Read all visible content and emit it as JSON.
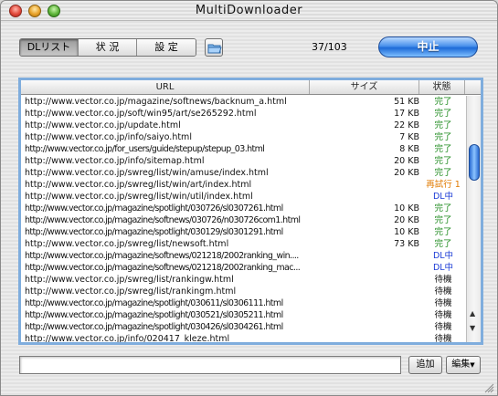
{
  "window": {
    "title": "MultiDownloader"
  },
  "toolbar": {
    "tabs": [
      "DLリスト",
      "状 況",
      "設 定"
    ],
    "counter": "37/103",
    "stop_label": "中止"
  },
  "list": {
    "headers": {
      "url": "URL",
      "size": "サイズ",
      "state": "状態"
    },
    "rows": [
      {
        "url": "http://www.vector.co.jp/magazine/softnews/backnum_a.html",
        "size": "51 KB",
        "state": "完了",
        "kind": "done",
        "compact": false
      },
      {
        "url": "http://www.vector.co.jp/soft/win95/art/se265292.html",
        "size": "17 KB",
        "state": "完了",
        "kind": "done",
        "compact": false
      },
      {
        "url": "http://www.vector.co.jp/update.html",
        "size": "22 KB",
        "state": "完了",
        "kind": "done",
        "compact": false
      },
      {
        "url": "http://www.vector.co.jp/info/saiyo.html",
        "size": "7 KB",
        "state": "完了",
        "kind": "done",
        "compact": false
      },
      {
        "url": "http://www.vector.co.jp/for_users/guide/stepup/stepup_03.html",
        "size": "8 KB",
        "state": "完了",
        "kind": "done",
        "compact": true
      },
      {
        "url": "http://www.vector.co.jp/info/sitemap.html",
        "size": "20 KB",
        "state": "完了",
        "kind": "done",
        "compact": false
      },
      {
        "url": "http://www.vector.co.jp/swreg/list/win/amuse/index.html",
        "size": "20 KB",
        "state": "完了",
        "kind": "done",
        "compact": false
      },
      {
        "url": "http://www.vector.co.jp/swreg/list/win/art/index.html",
        "size": "",
        "state": "再試行 1",
        "kind": "retry",
        "compact": false
      },
      {
        "url": "http://www.vector.co.jp/swreg/list/win/util/index.html",
        "size": "",
        "state": "DL中",
        "kind": "dl",
        "compact": false
      },
      {
        "url": "http://www.vector.co.jp/magazine/spotlight/030726/sl0307261.html",
        "size": "10 KB",
        "state": "完了",
        "kind": "done",
        "compact": true
      },
      {
        "url": "http://www.vector.co.jp/magazine/softnews/030726/n030726com1.html",
        "size": "20 KB",
        "state": "完了",
        "kind": "done",
        "compact": true
      },
      {
        "url": "http://www.vector.co.jp/magazine/spotlight/030129/sl0301291.html",
        "size": "10 KB",
        "state": "完了",
        "kind": "done",
        "compact": true
      },
      {
        "url": "http://www.vector.co.jp/swreg/list/newsoft.html",
        "size": "73 KB",
        "state": "完了",
        "kind": "done",
        "compact": false
      },
      {
        "url": "http://www.vector.co.jp/magazine/softnews/021218/2002ranking_win....",
        "size": "",
        "state": "DL中",
        "kind": "dl",
        "compact": true
      },
      {
        "url": "http://www.vector.co.jp/magazine/softnews/021218/2002ranking_mac...",
        "size": "",
        "state": "DL中",
        "kind": "dl",
        "compact": true
      },
      {
        "url": "http://www.vector.co.jp/swreg/list/rankingw.html",
        "size": "",
        "state": "待機",
        "kind": "wait",
        "compact": false
      },
      {
        "url": "http://www.vector.co.jp/swreg/list/rankingm.html",
        "size": "",
        "state": "待機",
        "kind": "wait",
        "compact": false
      },
      {
        "url": "http://www.vector.co.jp/magazine/spotlight/030611/sl0306111.html",
        "size": "",
        "state": "待機",
        "kind": "wait",
        "compact": true
      },
      {
        "url": "http://www.vector.co.jp/magazine/spotlight/030521/sl0305211.html",
        "size": "",
        "state": "待機",
        "kind": "wait",
        "compact": true
      },
      {
        "url": "http://www.vector.co.jp/magazine/spotlight/030426/sl0304261.html",
        "size": "",
        "state": "待機",
        "kind": "wait",
        "compact": true
      },
      {
        "url": "http://www.vector.co.jp/info/020417_kleze.html",
        "size": "",
        "state": "待機",
        "kind": "wait",
        "compact": false
      }
    ]
  },
  "bottom": {
    "input_value": "",
    "add_label": "追加",
    "edit_label": "編集"
  },
  "colors": {
    "done": "#1f8b1f",
    "retry": "#e07a00",
    "dl": "#1b3bd6",
    "stop_button": "#1d6ad7",
    "list_border": "#7faddd"
  },
  "icons": [
    "close-icon",
    "minimize-icon",
    "zoom-icon",
    "folder-icon",
    "scroll-up-arrow-icon",
    "scroll-down-arrow-icon",
    "resize-grip-icon"
  ]
}
